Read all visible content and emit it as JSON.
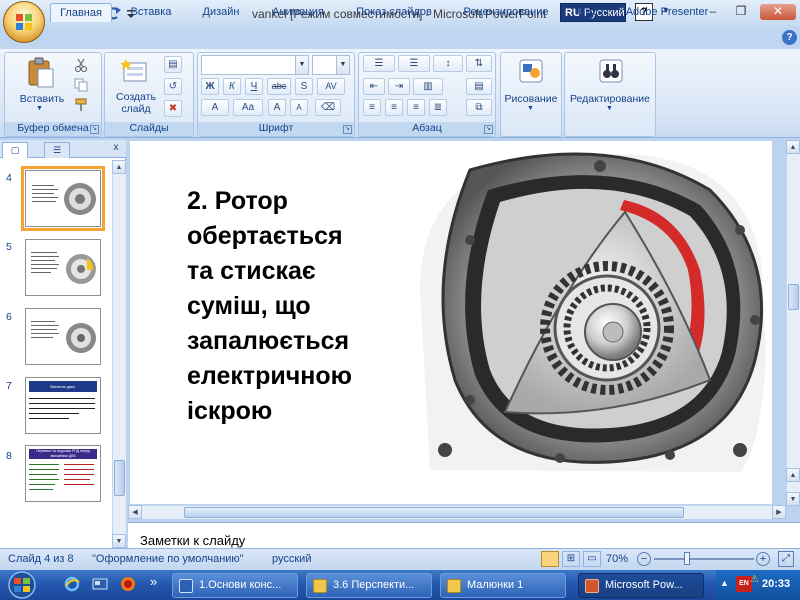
{
  "window": {
    "title": "vankel [Режим совместимости] - Microsoft PowerPoint",
    "lang_code": "RU",
    "lang_name": "Русский",
    "help_symbol": "?",
    "minimize": "–",
    "maximize": "❐",
    "close": "✕"
  },
  "tabs": [
    "Главная",
    "Вставка",
    "Дизайн",
    "Анимация",
    "Показ слайдов",
    "Рецензирование",
    "Вид",
    "Adobe Presenter"
  ],
  "ribbon": {
    "paste_label": "Вставить",
    "new_slide_label": "Создать слайд",
    "drawing_label": "Рисование",
    "editing_label": "Редактирование",
    "groups": {
      "clipboard": "Буфер обмена",
      "slides": "Слайды",
      "font": "Шрифт",
      "paragraph": "Абзац"
    },
    "font_buttons": [
      "Ж",
      "К",
      "Ч",
      "abc",
      "S",
      "AV"
    ],
    "font_size_buttons": [
      "A",
      "Aa",
      "A",
      "A"
    ]
  },
  "thumbnails": [
    {
      "num": "4",
      "selected": true
    },
    {
      "num": "5",
      "selected": false
    },
    {
      "num": "6",
      "selected": false
    },
    {
      "num": "7",
      "selected": false,
      "title": "Ванкель   двиг."
    },
    {
      "num": "8",
      "selected": false,
      "title": "Переваги та недоліки РПД перед звичайним ДВЗ"
    }
  ],
  "slide": {
    "lines": [
      "2. Ротор",
      "обертається",
      "та стискає",
      "суміш, що",
      "запалюється",
      "електричною",
      "іскрою"
    ]
  },
  "notes": {
    "placeholder": "Заметки к слайду"
  },
  "status": {
    "slide_info": "Слайд 4 из 8",
    "theme": "\"Оформление по умолчанию\"",
    "language": "русский",
    "zoom": "70%",
    "zoom_percent": 70
  },
  "taskbar": {
    "items": [
      {
        "label": "1.Основи конс...",
        "active": false
      },
      {
        "label": "3.6 Перспекти...",
        "active": false
      },
      {
        "label": "Малюнки 1",
        "active": false
      },
      {
        "label": "Microsoft Pow...",
        "active": true
      }
    ],
    "more": "»",
    "clock": "20:33",
    "tray_lang": "EN"
  },
  "colors": {
    "accent": "#15428b",
    "ribbon": "#dbe7f7",
    "selection": "#f6a333",
    "taskbar": "#2357ad"
  }
}
